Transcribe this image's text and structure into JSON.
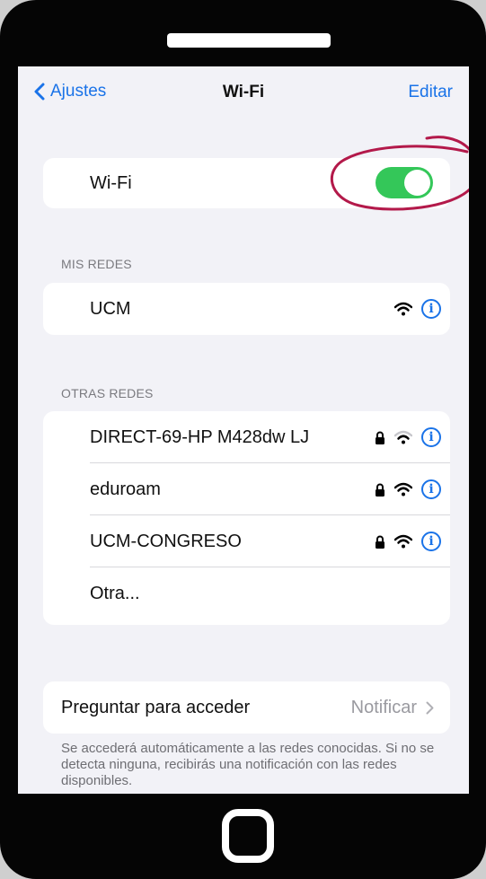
{
  "nav": {
    "back_label": "Ajustes",
    "title": "Wi-Fi",
    "edit_label": "Editar"
  },
  "wifi_toggle": {
    "label": "Wi-Fi",
    "state": "on",
    "color": "#34c759"
  },
  "my_networks": {
    "header": "MIS REDES",
    "items": [
      {
        "name": "UCM",
        "locked": false,
        "signal": "full"
      }
    ]
  },
  "other_networks": {
    "header": "OTRAS REDES",
    "items": [
      {
        "name": "DIRECT-69-HP M428dw LJ",
        "locked": true,
        "signal": "weak"
      },
      {
        "name": "eduroam",
        "locked": true,
        "signal": "full"
      },
      {
        "name": "UCM-CONGRESO",
        "locked": true,
        "signal": "full"
      },
      {
        "name": "Otra...",
        "locked": false,
        "signal": "none"
      }
    ]
  },
  "ask_to_join": {
    "label": "Preguntar para acceder",
    "value": "Notificar"
  },
  "footer_text": "Se accederá automáticamente a las redes conocidas. Si no se detecta ninguna, recibirás una notificación con las redes disponibles.",
  "accent_color": "#1a73e8",
  "annotation_color": "#b3194a"
}
